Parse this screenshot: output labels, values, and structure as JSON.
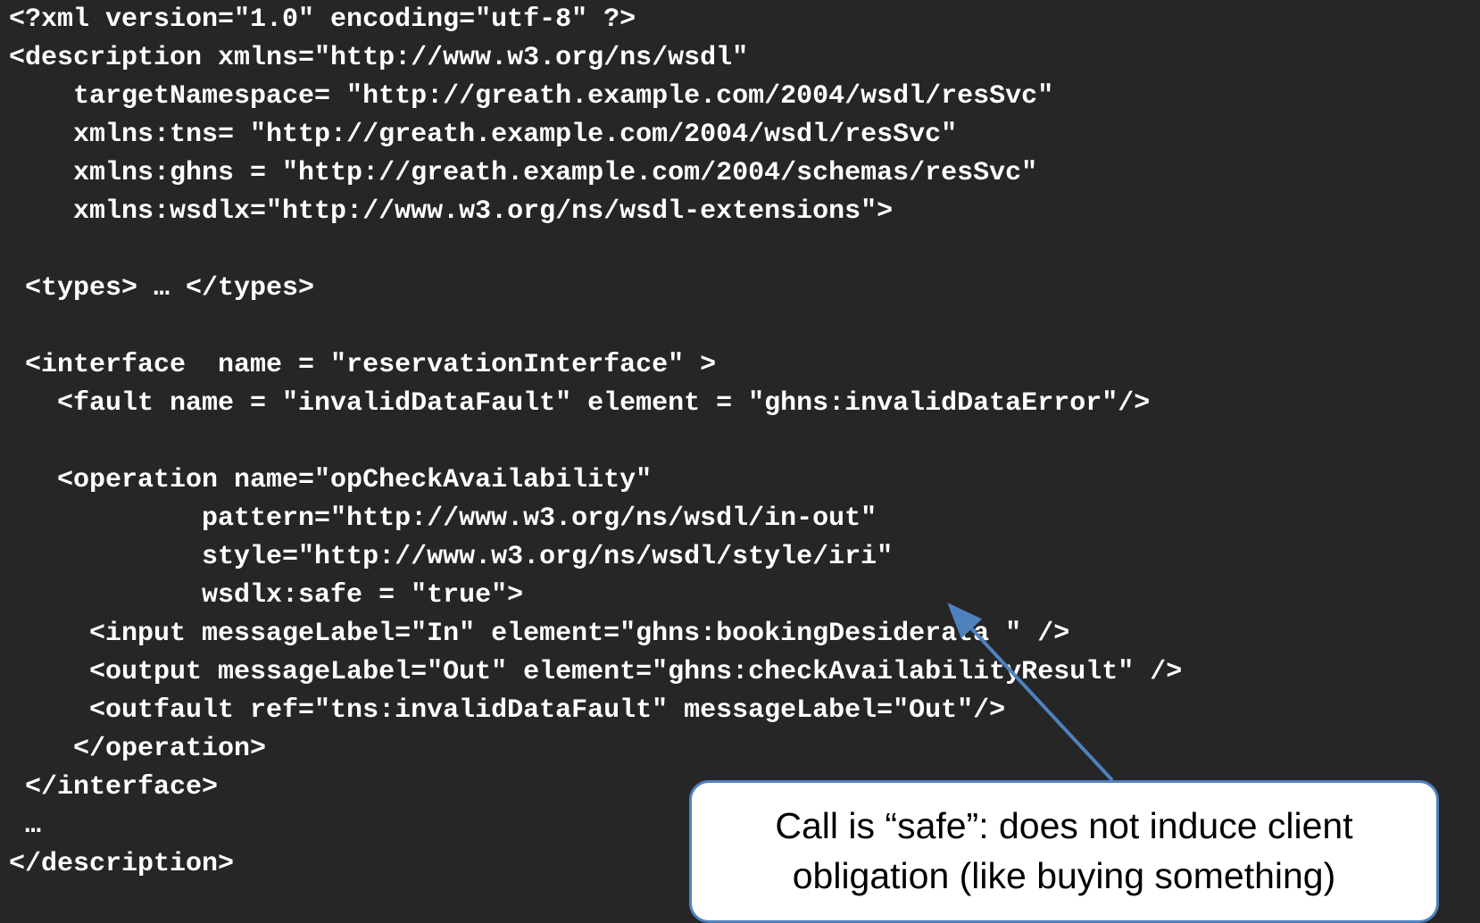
{
  "code_lines": [
    "<?xml version=\"1.0\" encoding=\"utf-8\" ?>",
    "<description xmlns=\"http://www.w3.org/ns/wsdl\"",
    "    targetNamespace= \"http://greath.example.com/2004/wsdl/resSvc\"",
    "    xmlns:tns= \"http://greath.example.com/2004/wsdl/resSvc\"",
    "    xmlns:ghns = \"http://greath.example.com/2004/schemas/resSvc\"",
    "    xmlns:wsdlx=\"http://www.w3.org/ns/wsdl-extensions\">",
    "",
    " <types> … </types>",
    "",
    " <interface  name = \"reservationInterface\" >",
    "   <fault name = \"invalidDataFault\" element = \"ghns:invalidDataError\"/>",
    "",
    "   <operation name=\"opCheckAvailability\"",
    "            pattern=\"http://www.w3.org/ns/wsdl/in-out\"",
    "            style=\"http://www.w3.org/ns/wsdl/style/iri\"",
    "            wsdlx:safe = \"true\">",
    "     <input messageLabel=\"In\" element=\"ghns:bookingDesiderata \" />",
    "     <output messageLabel=\"Out\" element=\"ghns:checkAvailabilityResult\" />",
    "     <outfault ref=\"tns:invalidDataFault\" messageLabel=\"Out\"/>",
    "    </operation>",
    " </interface>",
    " …",
    "</description>"
  ],
  "callout": {
    "line1": "Call is “safe”: does not induce client",
    "line2": "obligation (like buying something)"
  },
  "colors": {
    "background": "#262626",
    "code_text": "#ffffff",
    "callout_border": "#4f81bd",
    "arrow": "#4f81bd"
  }
}
